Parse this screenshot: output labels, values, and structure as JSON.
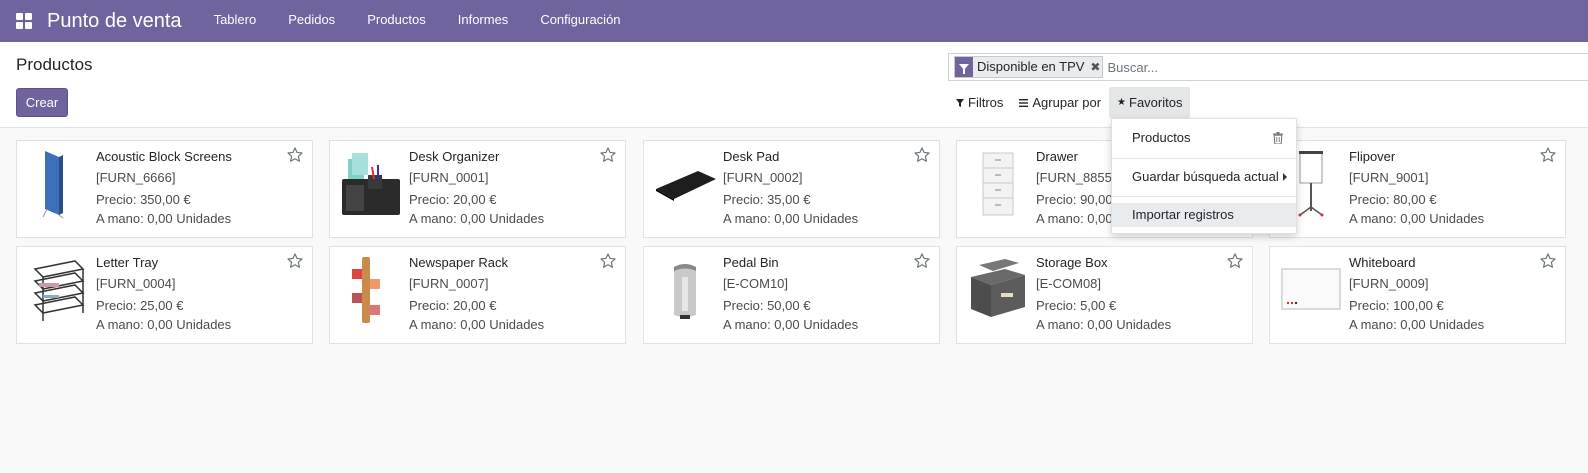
{
  "navbar": {
    "apps_icon": "apps-grid-icon",
    "brand": "Punto de venta",
    "menu": [
      "Tablero",
      "Pedidos",
      "Productos",
      "Informes",
      "Configuración"
    ]
  },
  "control_panel": {
    "title": "Productos",
    "create_label": "Crear",
    "search": {
      "facet_icon": "filter-icon",
      "facet_label": "Disponible en TPV",
      "facet_remove": "✖",
      "placeholder": "Buscar..."
    },
    "options": {
      "filters_label": "Filtros",
      "groupby_label": "Agrupar por",
      "favorites_label": "Favoritos"
    }
  },
  "favorites_dropdown": {
    "saved_filter": "Productos",
    "save_search": "Guardar búsqueda actual",
    "import_records": "Importar registros"
  },
  "products": [
    {
      "name": "Acoustic Block Screens",
      "code": "[FURN_6666]",
      "price": "Precio: 350,00 €",
      "stock": "A mano: 0,00 Unidades",
      "image": "acoustic-screen"
    },
    {
      "name": "Desk Organizer",
      "code": "[FURN_0001]",
      "price": "Precio: 20,00 €",
      "stock": "A mano: 0,00 Unidades",
      "image": "desk-organizer"
    },
    {
      "name": "Desk Pad",
      "code": "[FURN_0002]",
      "price": "Precio: 35,00 €",
      "stock": "A mano: 0,00 Unidades",
      "image": "desk-pad"
    },
    {
      "name": "Drawer",
      "code": "[FURN_8855]",
      "price": "Precio: 90,00 €",
      "stock": "A mano: 0,00 Unidades",
      "image": "drawer"
    },
    {
      "name": "Flipover",
      "code": "[FURN_9001]",
      "price": "Precio: 80,00 €",
      "stock": "A mano: 0,00 Unidades",
      "image": "flipover"
    },
    {
      "name": "Letter Tray",
      "code": "[FURN_0004]",
      "price": "Precio: 25,00 €",
      "stock": "A mano: 0,00 Unidades",
      "image": "letter-tray"
    },
    {
      "name": "Newspaper Rack",
      "code": "[FURN_0007]",
      "price": "Precio: 20,00 €",
      "stock": "A mano: 0,00 Unidades",
      "image": "newspaper-rack"
    },
    {
      "name": "Pedal Bin",
      "code": "[E-COM10]",
      "price": "Precio: 50,00 €",
      "stock": "A mano: 0,00 Unidades",
      "image": "pedal-bin"
    },
    {
      "name": "Storage Box",
      "code": "[E-COM08]",
      "price": "Precio: 5,00 €",
      "stock": "A mano: 0,00 Unidades",
      "image": "storage-box"
    },
    {
      "name": "Whiteboard",
      "code": "[FURN_0009]",
      "price": "Precio: 100,00 €",
      "stock": "A mano: 0,00 Unidades",
      "image": "whiteboard"
    }
  ],
  "colors": {
    "brand": "#71639e",
    "background": "#f9f9fa"
  }
}
